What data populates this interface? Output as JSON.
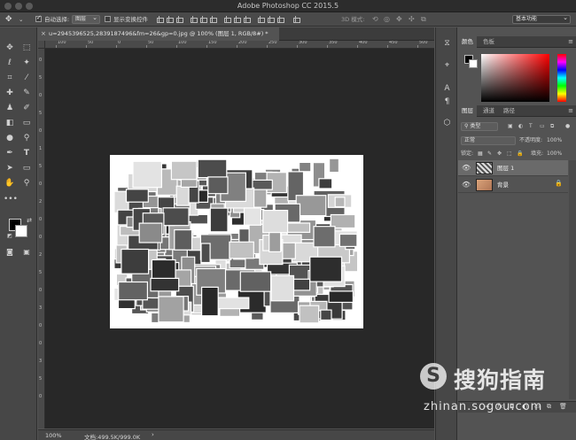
{
  "app": {
    "title": "Adobe Photoshop CC 2015.5"
  },
  "options": {
    "auto_select_label": "自动选择:",
    "auto_select_value": "图层",
    "show_transform_label": "显示变换控件",
    "mode_3d_label": "3D 模式:",
    "workspace": "基本功能"
  },
  "document": {
    "tab_title": "u=2945396525,2839187496&fm=26&gp=0.jpg @ 100% (图层 1, RGB/8#) *",
    "close_glyph": "×"
  },
  "rulers": {
    "top": [
      "100",
      "50",
      "0",
      "50",
      "100",
      "150",
      "200",
      "250",
      "300",
      "350",
      "400",
      "450",
      "500"
    ],
    "left": [
      "0",
      "5",
      "0",
      "5",
      "0",
      "1",
      "5",
      "0",
      "2",
      "0",
      "0",
      "2",
      "5",
      "0",
      "3",
      "0",
      "0",
      "3",
      "5",
      "0"
    ]
  },
  "status": {
    "zoom": "100%",
    "doc_info": "文档:499.5K/999.0K"
  },
  "color_panel": {
    "tabs": [
      "颜色",
      "色板"
    ],
    "fg_color": "#000000",
    "bg_color": "#ffffff",
    "picked_color": "#ff0000"
  },
  "layers_panel": {
    "tabs": [
      "图层",
      "通道",
      "路径"
    ],
    "filter_kind": "类型",
    "blend_mode": "正常",
    "opacity_label": "不透明度:",
    "opacity_value": "100%",
    "lock_label": "锁定:",
    "fill_label": "填充:",
    "fill_value": "100%",
    "layers": [
      {
        "name": "图层 1",
        "selected": true
      },
      {
        "name": "背景",
        "locked": true
      }
    ]
  },
  "watermark": {
    "logo": "S",
    "brand": "搜狗指南",
    "url": "zhinan.sogou.com"
  },
  "icons": {
    "tools": [
      "move-icon",
      "marquee-icon",
      "lasso-icon",
      "magic-wand-icon",
      "crop-icon",
      "eyedropper-icon",
      "healing-icon",
      "brush-icon",
      "stamp-icon",
      "history-brush-icon",
      "eraser-icon",
      "gradient-icon",
      "blur-icon",
      "dodge-icon",
      "pen-icon",
      "type-icon",
      "path-select-icon",
      "rectangle-icon",
      "hand-icon",
      "zoom-icon",
      "more-icon"
    ]
  }
}
